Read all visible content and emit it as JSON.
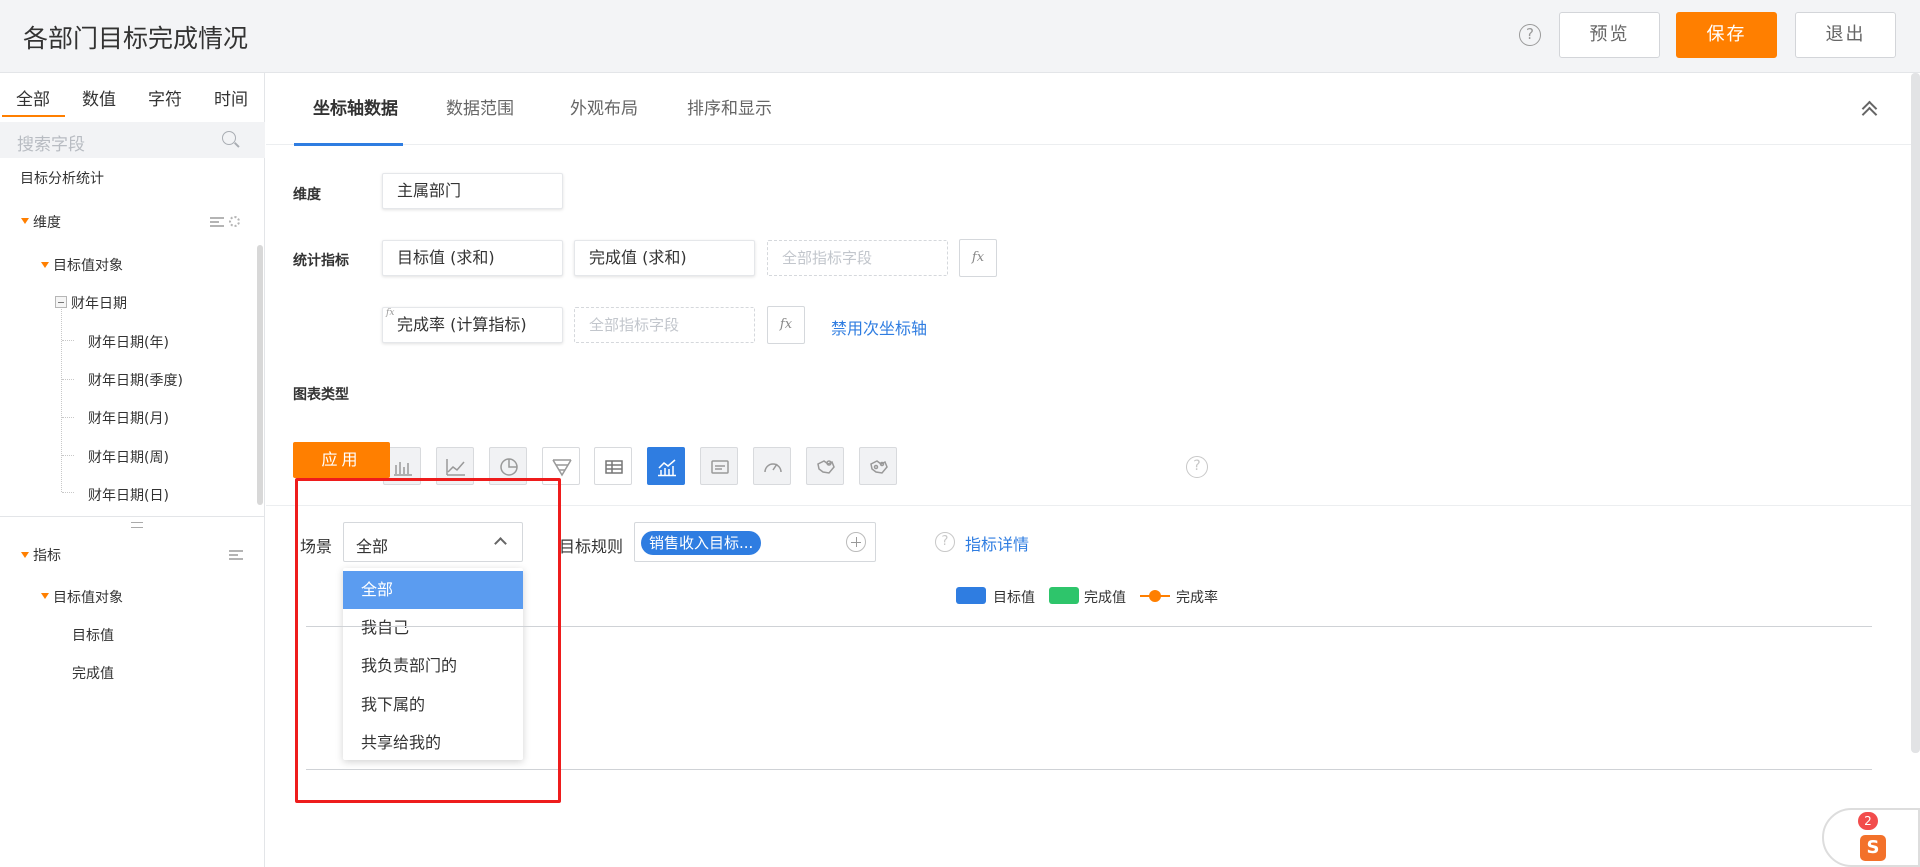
{
  "header": {
    "title": "各部门目标完成情况",
    "help": "?",
    "preview": "预览",
    "save": "保存",
    "quit": "退出"
  },
  "sidebar": {
    "tabs": [
      "全部",
      "数值",
      "字符",
      "时间"
    ],
    "search_placeholder": "搜索字段",
    "root": "目标分析统计",
    "dimension_group": "维度",
    "dimension_object": "目标值对象",
    "date_node": "财年日期",
    "date_children": [
      "财年日期(年)",
      "财年日期(季度)",
      "财年日期(月)",
      "财年日期(周)",
      "财年日期(日)"
    ],
    "measure_group": "指标",
    "measure_object": "目标值对象",
    "measures": [
      "目标值",
      "完成值"
    ]
  },
  "main": {
    "tabs": [
      "坐标轴数据",
      "数据范围",
      "外观布局",
      "排序和显示"
    ],
    "dimension_label": "维度",
    "dimension_value": "主属部门",
    "stat_label": "统计指标",
    "stat_fields": [
      "目标值 (求和)",
      "完成值 (求和)"
    ],
    "placeholder": "全部指标字段",
    "fx": "fx",
    "calc_field": "完成率 (计算指标)",
    "secondary_axis_link": "禁用次坐标轴",
    "chart_type_label": "图表类型",
    "apply": "应用"
  },
  "filters": {
    "scene_label": "场景",
    "scene_value": "全部",
    "scene_options": [
      "全部",
      "我自己",
      "我负责部门的",
      "我下属的",
      "共享给我的"
    ],
    "rule_label": "目标规则",
    "rule_tag": "销售收入目标...",
    "detail_link": "指标详情"
  },
  "legend": {
    "items": [
      "目标值",
      "完成值",
      "完成率"
    ],
    "colors": [
      "#2f7de1",
      "#2ec56b",
      "#ff7f00"
    ]
  },
  "ime": {
    "badge": "2",
    "logo": "S"
  },
  "colors": {
    "accent": "#ff7f00",
    "primary": "#2f7de1",
    "highlight": "#ee1c1c"
  }
}
